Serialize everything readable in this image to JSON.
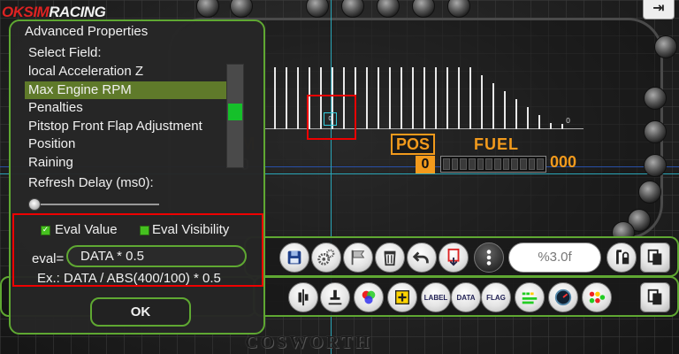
{
  "app": {
    "logo_part1": "OKSIM",
    "logo_part2": "RACING",
    "exit_icon": "exit-icon"
  },
  "dashboard": {
    "pos_label": "POS",
    "pos_value": "0",
    "fuel_label": "FUEL",
    "fuel_value": "000",
    "rpm_readout": "0",
    "widget_value": "0",
    "ghost_label": "M",
    "ghost_value": "0",
    "brand_text": "COSWORTH"
  },
  "dialog": {
    "title": "Advanced Properties",
    "select_field_label": "Select Field:",
    "fields": [
      "local Acceleration Z",
      "Max Engine RPM",
      "Penalties",
      "Pitstop Front Flap Adjustment",
      "Position",
      "Raining"
    ],
    "selected_index": 1,
    "refresh_delay_label": "Refresh Delay (ms0):",
    "eval_value_label": "Eval Value",
    "eval_visibility_label": "Eval Visibility",
    "eval_value_checked": true,
    "eval_visibility_checked": true,
    "eval_label": "eval=",
    "eval_expression": "DATA * 0.5",
    "example_text": "Ex.: DATA / ABS(400/100) * 0.5",
    "ok_label": "OK"
  },
  "toolbar1": {
    "format_value": "%3.0f",
    "buttons": [
      "save-icon",
      "settings-gears-icon",
      "flag-icon",
      "trash-icon",
      "undo-icon",
      "bracket-arrow-icon",
      "more-vertical-icon",
      "lock-icon",
      "copy-icon"
    ]
  },
  "toolbar2": {
    "label_button": "LABEL",
    "data_button": "DATA",
    "flag_button": "FLAG",
    "buttons": [
      "align-center-icon",
      "align-bottom-icon",
      "rgb-color-icon",
      "add-element-icon",
      "label-icon",
      "data-icon",
      "flag-icon",
      "rpm-leds-icon",
      "gauge-icon",
      "leds-icon",
      "copy-icon"
    ]
  },
  "colors": {
    "accent_green": "#5fa832",
    "selection": "#5f7a2a",
    "highlight_red": "#e00000",
    "dash_orange": "#f29a1c",
    "guide_cyan": "#2aa6b8"
  }
}
